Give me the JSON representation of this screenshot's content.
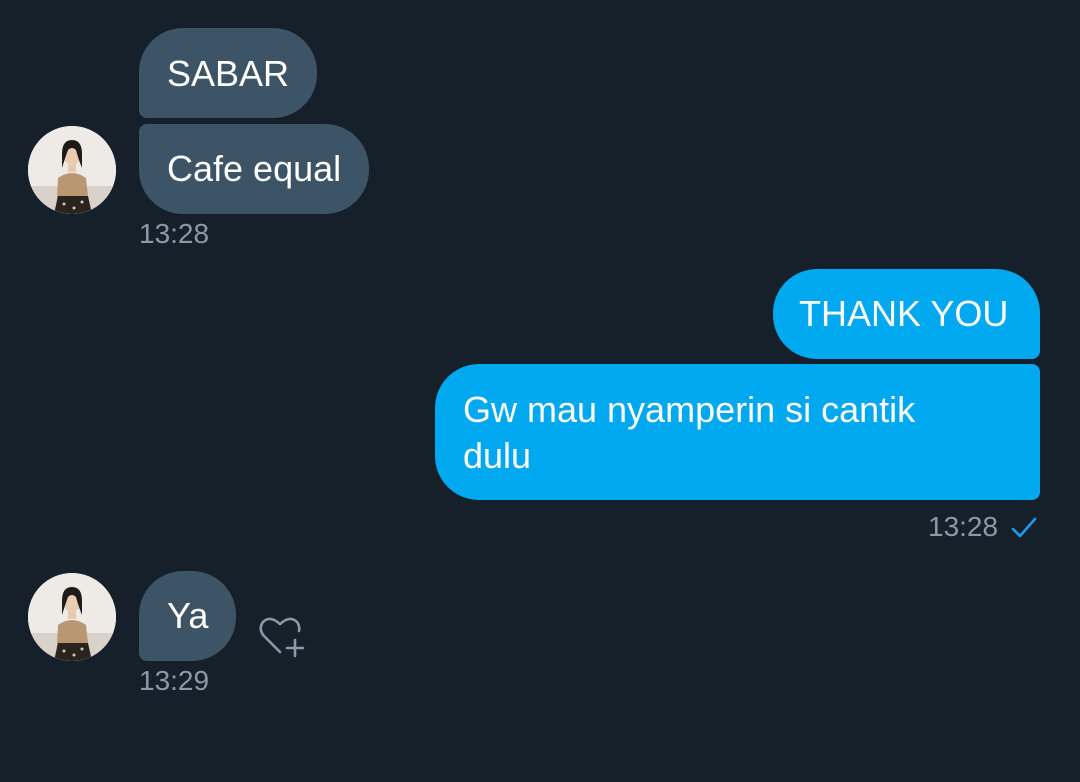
{
  "messages": [
    {
      "direction": "incoming",
      "text": "SABAR"
    },
    {
      "direction": "incoming",
      "text": "Cafe equal",
      "time": "13:28"
    },
    {
      "direction": "outgoing",
      "text": "THANK YOU"
    },
    {
      "direction": "outgoing",
      "text_line1": "Gw mau nyamperin si cantik",
      "text_line2": "dulu",
      "time": "13:28",
      "status": "sent"
    },
    {
      "direction": "incoming",
      "text": "Ya",
      "time": "13:29"
    }
  ],
  "icons": {
    "sent_status": "checkmark-icon",
    "reaction": "heart-plus-icon"
  },
  "colors": {
    "background": "#15202b",
    "incoming_bubble": "#3d5466",
    "outgoing_bubble": "#00a8f0",
    "timestamp": "#8b98a5",
    "check": "#1d9bf0"
  }
}
